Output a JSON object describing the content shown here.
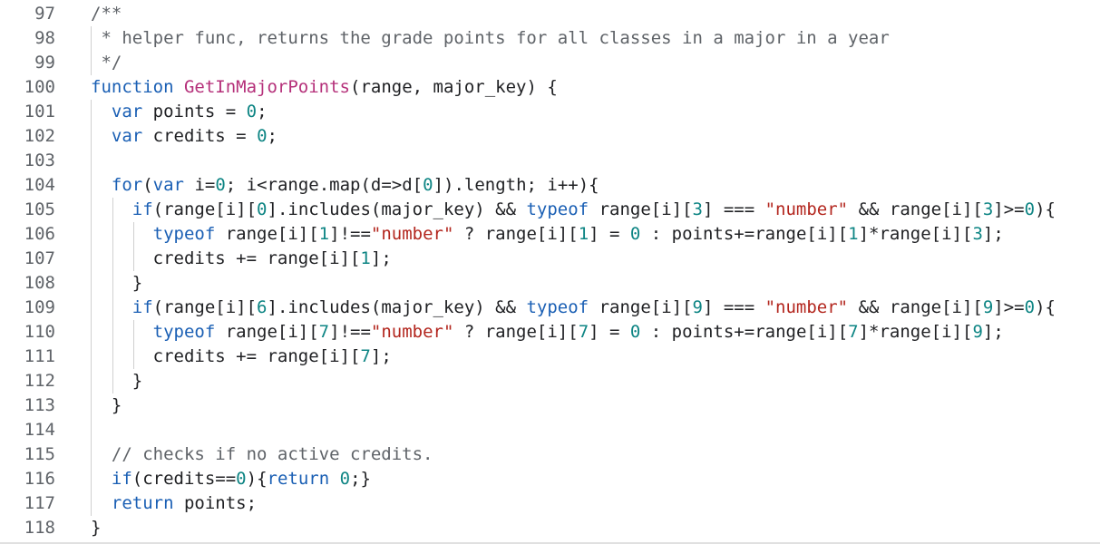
{
  "editor": {
    "colors": {
      "background": "#ffffff",
      "line_number": "#5f6368",
      "default": "#202124",
      "keyword": "#1a5fb4",
      "function": "#b5307a",
      "number": "#0e8584",
      "string": "#b3261e",
      "comment": "#5f6368"
    },
    "lines": [
      {
        "number": "97",
        "tokens": [
          {
            "t": "/**",
            "c": "comment"
          }
        ]
      },
      {
        "number": "98",
        "tokens": [
          {
            "t": " * helper func, returns the grade points for all classes in a major in a year",
            "c": "comment"
          }
        ]
      },
      {
        "number": "99",
        "tokens": [
          {
            "t": " */",
            "c": "comment"
          }
        ]
      },
      {
        "number": "100",
        "tokens": [
          {
            "t": "function",
            "c": "keyword"
          },
          {
            "t": " ",
            "c": "default"
          },
          {
            "t": "GetInMajorPoints",
            "c": "function"
          },
          {
            "t": "(range, major_key) {",
            "c": "default"
          }
        ]
      },
      {
        "number": "101",
        "tokens": [
          {
            "t": "  ",
            "c": "default"
          },
          {
            "t": "var",
            "c": "keyword"
          },
          {
            "t": " points = ",
            "c": "default"
          },
          {
            "t": "0",
            "c": "number"
          },
          {
            "t": ";",
            "c": "default"
          }
        ]
      },
      {
        "number": "102",
        "tokens": [
          {
            "t": "  ",
            "c": "default"
          },
          {
            "t": "var",
            "c": "keyword"
          },
          {
            "t": " credits = ",
            "c": "default"
          },
          {
            "t": "0",
            "c": "number"
          },
          {
            "t": ";",
            "c": "default"
          }
        ]
      },
      {
        "number": "103",
        "tokens": []
      },
      {
        "number": "104",
        "tokens": [
          {
            "t": "  ",
            "c": "default"
          },
          {
            "t": "for",
            "c": "keyword"
          },
          {
            "t": "(",
            "c": "default"
          },
          {
            "t": "var",
            "c": "keyword"
          },
          {
            "t": " i=",
            "c": "default"
          },
          {
            "t": "0",
            "c": "number"
          },
          {
            "t": "; i<range.map(d=>d[",
            "c": "default"
          },
          {
            "t": "0",
            "c": "number"
          },
          {
            "t": "]).length; i++){",
            "c": "default"
          }
        ]
      },
      {
        "number": "105",
        "tokens": [
          {
            "t": "    ",
            "c": "default"
          },
          {
            "t": "if",
            "c": "keyword"
          },
          {
            "t": "(range[i][",
            "c": "default"
          },
          {
            "t": "0",
            "c": "number"
          },
          {
            "t": "].includes(major_key) && ",
            "c": "default"
          },
          {
            "t": "typeof",
            "c": "keyword"
          },
          {
            "t": " range[i][",
            "c": "default"
          },
          {
            "t": "3",
            "c": "number"
          },
          {
            "t": "] === ",
            "c": "default"
          },
          {
            "t": "\"number\"",
            "c": "string"
          },
          {
            "t": " && range[i][",
            "c": "default"
          },
          {
            "t": "3",
            "c": "number"
          },
          {
            "t": "]>=",
            "c": "default"
          },
          {
            "t": "0",
            "c": "number"
          },
          {
            "t": "){",
            "c": "default"
          }
        ]
      },
      {
        "number": "106",
        "tokens": [
          {
            "t": "      ",
            "c": "default"
          },
          {
            "t": "typeof",
            "c": "keyword"
          },
          {
            "t": " range[i][",
            "c": "default"
          },
          {
            "t": "1",
            "c": "number"
          },
          {
            "t": "]!==",
            "c": "default"
          },
          {
            "t": "\"number\"",
            "c": "string"
          },
          {
            "t": " ? range[i][",
            "c": "default"
          },
          {
            "t": "1",
            "c": "number"
          },
          {
            "t": "] = ",
            "c": "default"
          },
          {
            "t": "0",
            "c": "number"
          },
          {
            "t": " : points+=range[i][",
            "c": "default"
          },
          {
            "t": "1",
            "c": "number"
          },
          {
            "t": "]*range[i][",
            "c": "default"
          },
          {
            "t": "3",
            "c": "number"
          },
          {
            "t": "];",
            "c": "default"
          }
        ]
      },
      {
        "number": "107",
        "tokens": [
          {
            "t": "      credits += range[i][",
            "c": "default"
          },
          {
            "t": "1",
            "c": "number"
          },
          {
            "t": "];",
            "c": "default"
          }
        ]
      },
      {
        "number": "108",
        "tokens": [
          {
            "t": "    }",
            "c": "default"
          }
        ]
      },
      {
        "number": "109",
        "tokens": [
          {
            "t": "    ",
            "c": "default"
          },
          {
            "t": "if",
            "c": "keyword"
          },
          {
            "t": "(range[i][",
            "c": "default"
          },
          {
            "t": "6",
            "c": "number"
          },
          {
            "t": "].includes(major_key) && ",
            "c": "default"
          },
          {
            "t": "typeof",
            "c": "keyword"
          },
          {
            "t": " range[i][",
            "c": "default"
          },
          {
            "t": "9",
            "c": "number"
          },
          {
            "t": "] === ",
            "c": "default"
          },
          {
            "t": "\"number\"",
            "c": "string"
          },
          {
            "t": " && range[i][",
            "c": "default"
          },
          {
            "t": "9",
            "c": "number"
          },
          {
            "t": "]>=",
            "c": "default"
          },
          {
            "t": "0",
            "c": "number"
          },
          {
            "t": "){",
            "c": "default"
          }
        ]
      },
      {
        "number": "110",
        "tokens": [
          {
            "t": "      ",
            "c": "default"
          },
          {
            "t": "typeof",
            "c": "keyword"
          },
          {
            "t": " range[i][",
            "c": "default"
          },
          {
            "t": "7",
            "c": "number"
          },
          {
            "t": "]!==",
            "c": "default"
          },
          {
            "t": "\"number\"",
            "c": "string"
          },
          {
            "t": " ? range[i][",
            "c": "default"
          },
          {
            "t": "7",
            "c": "number"
          },
          {
            "t": "] = ",
            "c": "default"
          },
          {
            "t": "0",
            "c": "number"
          },
          {
            "t": " : points+=range[i][",
            "c": "default"
          },
          {
            "t": "7",
            "c": "number"
          },
          {
            "t": "]*range[i][",
            "c": "default"
          },
          {
            "t": "9",
            "c": "number"
          },
          {
            "t": "];",
            "c": "default"
          }
        ]
      },
      {
        "number": "111",
        "tokens": [
          {
            "t": "      credits += range[i][",
            "c": "default"
          },
          {
            "t": "7",
            "c": "number"
          },
          {
            "t": "];",
            "c": "default"
          }
        ]
      },
      {
        "number": "112",
        "tokens": [
          {
            "t": "    }",
            "c": "default"
          }
        ]
      },
      {
        "number": "113",
        "tokens": [
          {
            "t": "  }",
            "c": "default"
          }
        ]
      },
      {
        "number": "114",
        "tokens": []
      },
      {
        "number": "115",
        "tokens": [
          {
            "t": "  ",
            "c": "default"
          },
          {
            "t": "// checks if no active credits.",
            "c": "comment"
          }
        ]
      },
      {
        "number": "116",
        "tokens": [
          {
            "t": "  ",
            "c": "default"
          },
          {
            "t": "if",
            "c": "keyword"
          },
          {
            "t": "(credits==",
            "c": "default"
          },
          {
            "t": "0",
            "c": "number"
          },
          {
            "t": "){",
            "c": "default"
          },
          {
            "t": "return",
            "c": "keyword"
          },
          {
            "t": " ",
            "c": "default"
          },
          {
            "t": "0",
            "c": "number"
          },
          {
            "t": ";}",
            "c": "default"
          }
        ]
      },
      {
        "number": "117",
        "tokens": [
          {
            "t": "  ",
            "c": "default"
          },
          {
            "t": "return",
            "c": "keyword"
          },
          {
            "t": " points;",
            "c": "default"
          }
        ]
      },
      {
        "number": "118",
        "tokens": [
          {
            "t": "}",
            "c": "default"
          }
        ]
      }
    ]
  }
}
